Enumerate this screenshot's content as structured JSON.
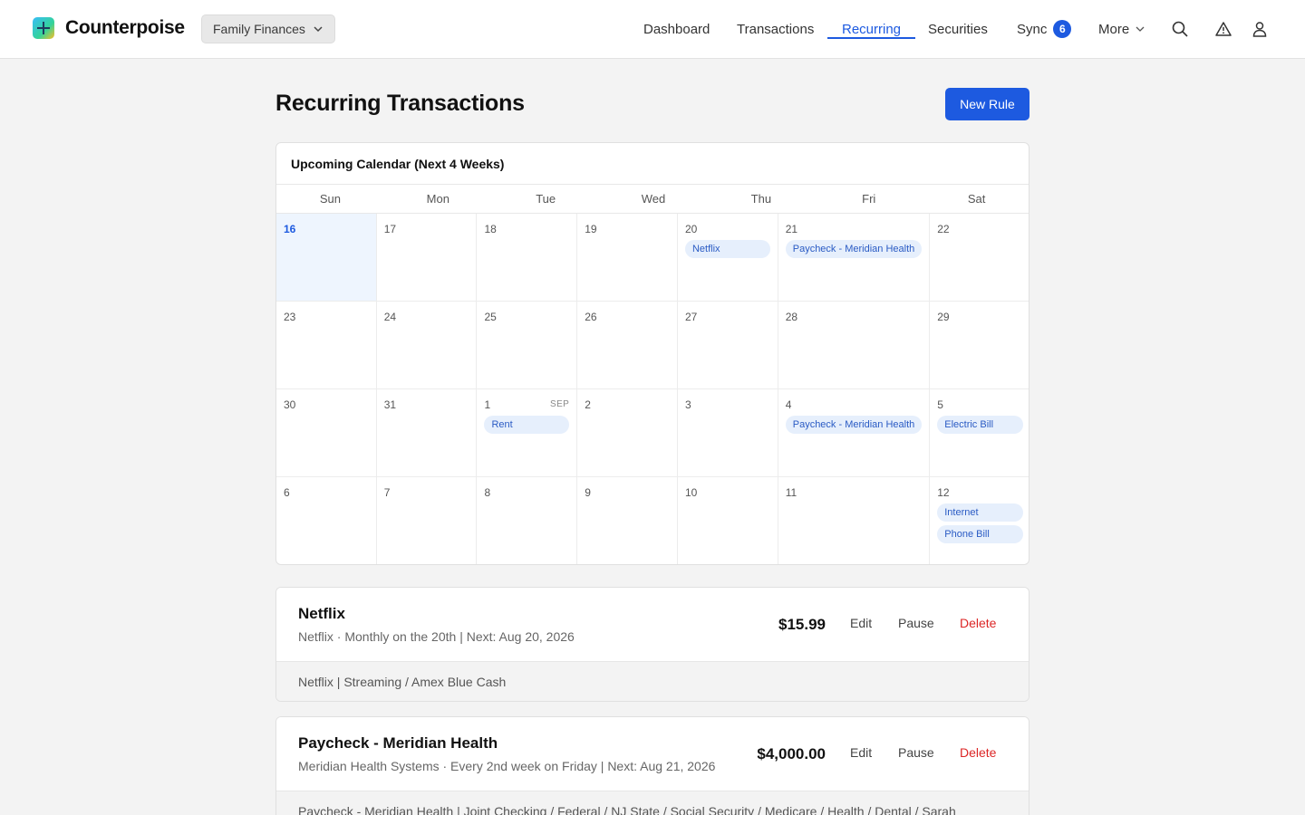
{
  "app": {
    "name": "Counterpoise",
    "account": "Family Finances"
  },
  "nav": {
    "dashboard": "Dashboard",
    "transactions": "Transactions",
    "recurring": "Recurring",
    "securities": "Securities",
    "sync": "Sync",
    "sync_count": "6",
    "more": "More",
    "active": "Recurring"
  },
  "page": {
    "title": "Recurring Transactions",
    "new_rule_label": "New Rule"
  },
  "calendar": {
    "title": "Upcoming Calendar (Next 4 Weeks)",
    "weekdays": [
      "Sun",
      "Mon",
      "Tue",
      "Wed",
      "Thu",
      "Fri",
      "Sat"
    ],
    "weeks": [
      [
        {
          "day": "16",
          "today": true,
          "events": []
        },
        {
          "day": "17",
          "events": []
        },
        {
          "day": "18",
          "events": []
        },
        {
          "day": "19",
          "events": []
        },
        {
          "day": "20",
          "events": [
            "Netflix"
          ]
        },
        {
          "day": "21",
          "events": [
            "Paycheck - Meridian Health"
          ]
        },
        {
          "day": "22",
          "events": []
        }
      ],
      [
        {
          "day": "23",
          "events": []
        },
        {
          "day": "24",
          "events": []
        },
        {
          "day": "25",
          "events": []
        },
        {
          "day": "26",
          "events": []
        },
        {
          "day": "27",
          "events": []
        },
        {
          "day": "28",
          "events": []
        },
        {
          "day": "29",
          "events": []
        }
      ],
      [
        {
          "day": "30",
          "events": []
        },
        {
          "day": "31",
          "events": []
        },
        {
          "day": "1",
          "month": "SEP",
          "events": [
            "Rent"
          ]
        },
        {
          "day": "2",
          "events": []
        },
        {
          "day": "3",
          "events": []
        },
        {
          "day": "4",
          "events": [
            "Paycheck - Meridian Health"
          ]
        },
        {
          "day": "5",
          "events": [
            "Electric Bill"
          ]
        }
      ],
      [
        {
          "day": "6",
          "events": []
        },
        {
          "day": "7",
          "events": []
        },
        {
          "day": "8",
          "events": []
        },
        {
          "day": "9",
          "events": []
        },
        {
          "day": "10",
          "events": []
        },
        {
          "day": "11",
          "events": []
        },
        {
          "day": "12",
          "events": [
            "Internet",
            "Phone Bill"
          ]
        }
      ]
    ]
  },
  "rules": [
    {
      "name": "Netflix",
      "meta": "Netflix · Monthly on the 20th | Next: Aug 20, 2026",
      "amount": "$15.99",
      "details": "Netflix | Streaming / Amex Blue Cash",
      "edit": "Edit",
      "pause": "Pause",
      "delete": "Delete"
    },
    {
      "name": "Paycheck - Meridian Health",
      "meta": "Meridian Health Systems · Every 2nd week on Friday | Next: Aug 21, 2026",
      "amount": "$4,000.00",
      "details": "Paycheck - Meridian Health | Joint Checking / Federal / NJ State / Social Security / Medicare / Health / Dental / Sarah",
      "edit": "Edit",
      "pause": "Pause",
      "delete": "Delete"
    }
  ],
  "colors": {
    "accent": "#1d5ae0",
    "danger": "#dc2626",
    "event_bg": "#e6effc",
    "today_bg": "#eef5fe"
  },
  "icons": [
    "logo-icon",
    "chevron-down-icon",
    "search-icon",
    "alert-triangle-icon",
    "user-icon"
  ]
}
